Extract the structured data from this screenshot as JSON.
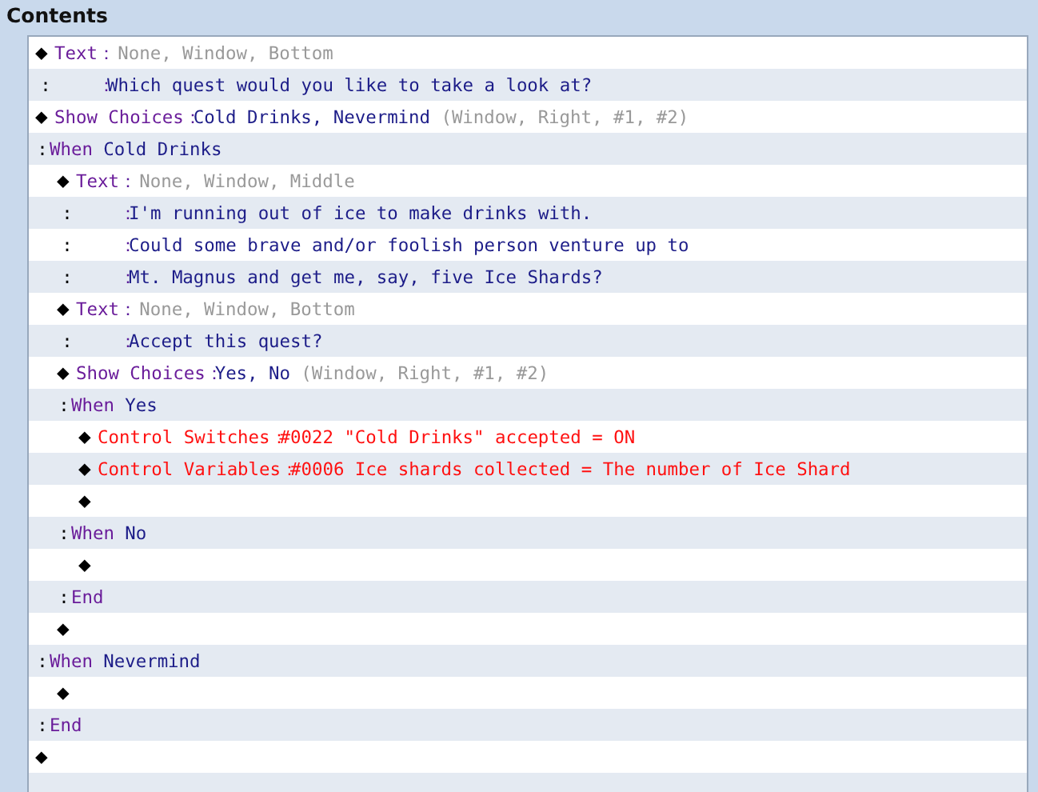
{
  "panel": {
    "title": "Contents"
  },
  "commands": [
    {
      "kind": "command",
      "lead": "◆",
      "name": "Text",
      "sep": "：",
      "note": "None, Window, Bottom",
      "alert": false,
      "lines": [
        {
          "lead": ":",
          "sep": "：",
          "value": "Which quest would you like to take a look at?"
        }
      ]
    },
    {
      "kind": "command",
      "lead": "◆",
      "name": "Show Choices",
      "sep": "：",
      "value": "Cold Drinks, Nevermind",
      "note": "(Window, Right, #1, #2)",
      "alert": false,
      "branches": [
        {
          "lead": ":",
          "name": "When",
          "value": "Cold Drinks",
          "children": [
            {
              "kind": "command",
              "lead": "◆",
              "name": "Text",
              "sep": "：",
              "note": "None, Window, Middle",
              "alert": false,
              "lines": [
                {
                  "lead": ":",
                  "sep": "：",
                  "value": "I'm running out of ice to make drinks with."
                },
                {
                  "lead": ":",
                  "sep": "：",
                  "value": "Could some brave and/or foolish person venture up to"
                },
                {
                  "lead": ":",
                  "sep": "：",
                  "value": "Mt. Magnus and get me, say, five Ice Shards?"
                }
              ]
            },
            {
              "kind": "command",
              "lead": "◆",
              "name": "Text",
              "sep": "：",
              "note": "None, Window, Bottom",
              "alert": false,
              "lines": [
                {
                  "lead": ":",
                  "sep": "：",
                  "value": "Accept this quest?"
                }
              ]
            },
            {
              "kind": "command",
              "lead": "◆",
              "name": "Show Choices",
              "sep": "：",
              "value": "Yes, No",
              "note": "(Window, Right, #1, #2)",
              "alert": false,
              "branches": [
                {
                  "lead": ":",
                  "name": "When",
                  "value": "Yes",
                  "children": [
                    {
                      "kind": "command",
                      "lead": "◆",
                      "name": "Control Switches",
                      "sep": "：",
                      "value": "#0022 \"Cold Drinks\" accepted = ON",
                      "alert": true
                    },
                    {
                      "kind": "command",
                      "lead": "◆",
                      "name": "Control Variables",
                      "sep": "：",
                      "value": "#0006 Ice shards collected = The number of Ice Shard",
                      "alert": true
                    },
                    {
                      "kind": "empty",
                      "lead": "◆"
                    }
                  ]
                },
                {
                  "lead": ":",
                  "name": "When",
                  "value": "No",
                  "children": [
                    {
                      "kind": "empty",
                      "lead": "◆"
                    }
                  ]
                },
                {
                  "lead": ":",
                  "name": "End"
                }
              ]
            },
            {
              "kind": "empty",
              "lead": "◆"
            }
          ]
        },
        {
          "lead": ":",
          "name": "When",
          "value": "Nevermind",
          "children": [
            {
              "kind": "empty",
              "lead": "◆"
            }
          ]
        },
        {
          "lead": ":",
          "name": "End"
        }
      ]
    },
    {
      "kind": "empty",
      "lead": "◆"
    }
  ]
}
